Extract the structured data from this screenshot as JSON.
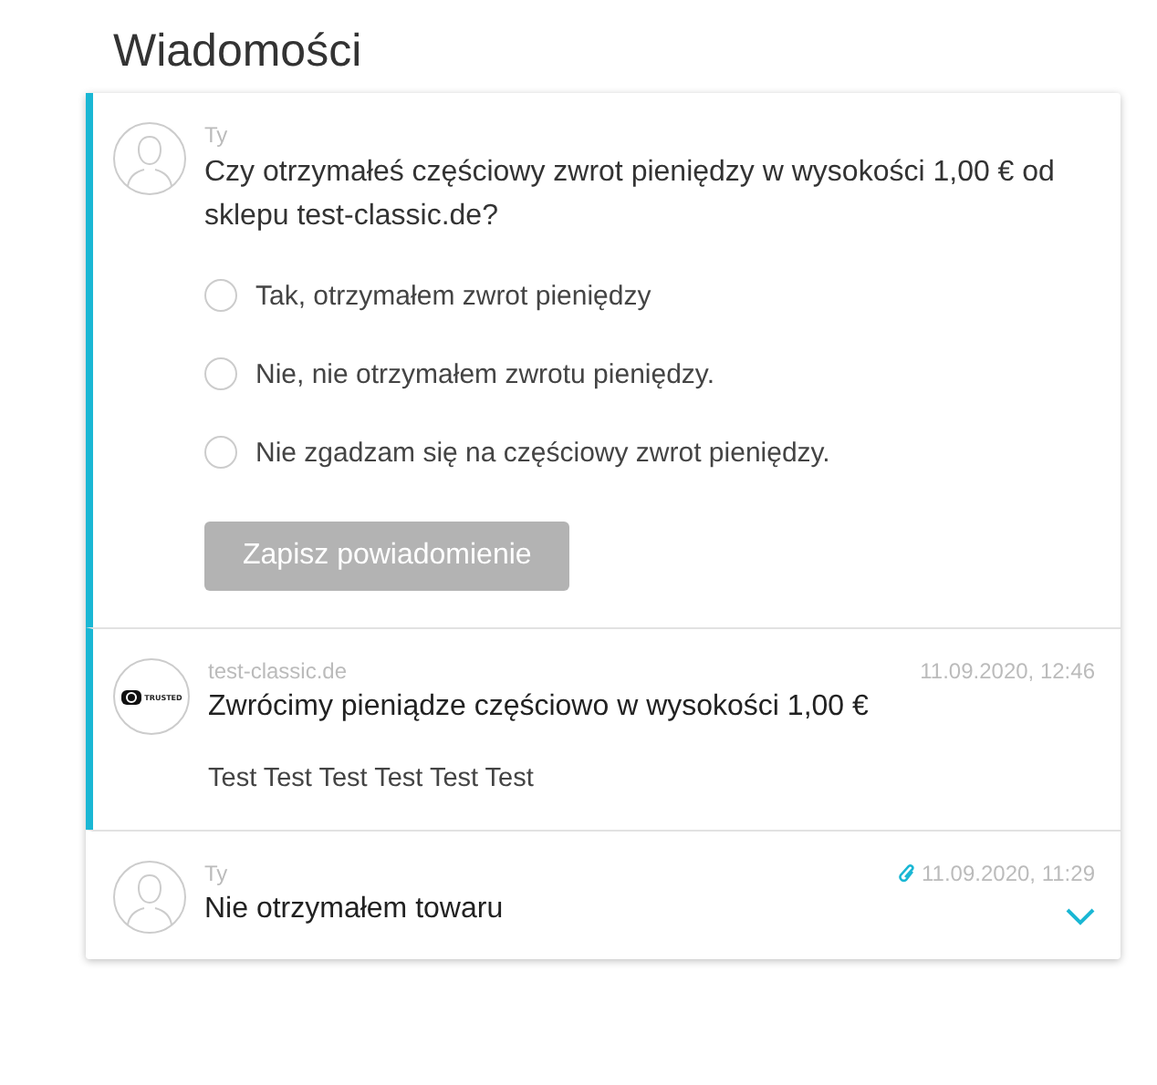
{
  "title": "Wiadomości",
  "messages": [
    {
      "kind": "question",
      "highlighted": true,
      "sender": "Ty",
      "text": "Czy otrzymałeś częściowy zwrot pieniędzy w wysokości 1,00 € od sklepu test-classic.de?",
      "options": [
        {
          "label": "Tak, otrzymałem zwrot pieniędzy",
          "selected": false
        },
        {
          "label": "Nie, nie otrzymałem zwrotu pieniędzy.",
          "selected": false
        },
        {
          "label": "Nie zgadzam się na częściowy zwrot pieniędzy.",
          "selected": false
        }
      ],
      "button": {
        "label": "Zapisz powiadomienie",
        "disabled": true
      }
    },
    {
      "kind": "message",
      "highlighted": true,
      "logo_text": "TRUSTED",
      "sender": "test-classic.de",
      "time": "11.09.2020, 12:46",
      "subject": "Zwrócimy pieniądze częściowo w wysokości 1,00 €",
      "body": "Test Test Test Test Test Test"
    },
    {
      "kind": "collapsed",
      "highlighted": false,
      "sender": "Ty",
      "time": "11.09.2020, 11:29",
      "attachment": true,
      "subject": "Nie otrzymałem towaru",
      "expanded": false
    }
  ]
}
